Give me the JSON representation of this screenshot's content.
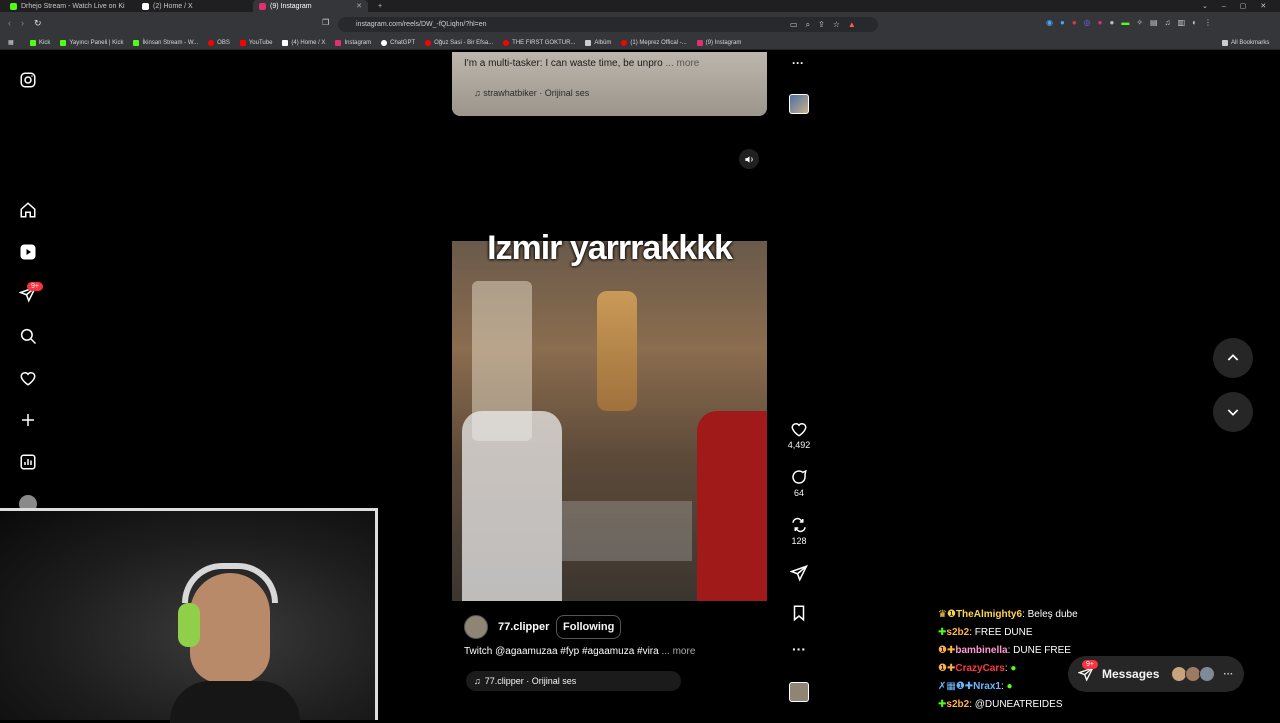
{
  "browser": {
    "tabs": [
      {
        "title": "Drhejo Stream - Watch Live on Ki",
        "color": "#53fc18"
      },
      {
        "title": "(2) Home / X",
        "color": "#ffffff"
      },
      {
        "title": "(9) Instagram",
        "color": "#e1306c"
      }
    ],
    "url": "instagram.com/reels/DW_-fQLiqhn/?hl=en",
    "bookmarks": [
      {
        "label": "Kick",
        "color": "#53fc18"
      },
      {
        "label": "Yayıncı Paneli | Kick",
        "color": "#53fc18"
      },
      {
        "label": "İkinsan Stream - W...",
        "color": "#53fc18"
      },
      {
        "label": "OBS",
        "color": "#ff0000"
      },
      {
        "label": "YouTube",
        "color": "#ff0000"
      },
      {
        "label": "(4) Home / X",
        "color": "#ffffff"
      },
      {
        "label": "Instagram",
        "color": "#e1306c"
      },
      {
        "label": "ChatGPT",
        "color": "#ffffff"
      },
      {
        "label": "Oğuz Sasi - Bir Efsa...",
        "color": "#ff0000"
      },
      {
        "label": "THE FIRST GOKTUR...",
        "color": "#ff0000"
      },
      {
        "label": "Albüm",
        "color": "#cccccc"
      },
      {
        "label": "(1) Meprez Offical -...",
        "color": "#ff0000"
      },
      {
        "label": "(9) Instagram",
        "color": "#e1306c"
      }
    ],
    "all_bookmarks": "All Bookmarks"
  },
  "sidebar": {
    "notification_badge": "9+"
  },
  "previous_reel": {
    "caption": "I'm a multi-tasker: I can waste time, be unpro",
    "more": "... more",
    "audio": "strawhatbiker · Orijinal ses"
  },
  "reel": {
    "overlay_text": "Izmir yarrrakkkk",
    "username": "77.clipper",
    "follow_label": "Following",
    "caption": "Twitch @agaamuzaa #fyp #agaamuza #vira",
    "more": "... more",
    "audio": "77.clipper · Orijinal ses",
    "likes": "4,492",
    "comments": "64",
    "reposts": "128"
  },
  "chat": [
    {
      "user": "TheAlmighty6",
      "msg": ": Beleş dube",
      "color": "#ffd54a",
      "badge": "♛❶"
    },
    {
      "user": "s2b2",
      "msg": ": FREE DUNE",
      "color": "#ffb347",
      "badge": "✚"
    },
    {
      "user": "bambinella",
      "msg": ": DUNE FREE",
      "color": "#ff9ad5",
      "badge": "❶✚"
    },
    {
      "user": "CrazyCars",
      "msg": ":",
      "color": "#ff3b3b",
      "badge": "❶✚"
    },
    {
      "user": "Nrax1",
      "msg": ":",
      "color": "#6ab7ff",
      "badge": "✗▦❶✚"
    },
    {
      "user": "s2b2",
      "msg": ": @DUNEATREIDES",
      "color": "#ffb347",
      "badge": "✚"
    }
  ],
  "messages": {
    "label": "Messages",
    "badge": "9+"
  }
}
